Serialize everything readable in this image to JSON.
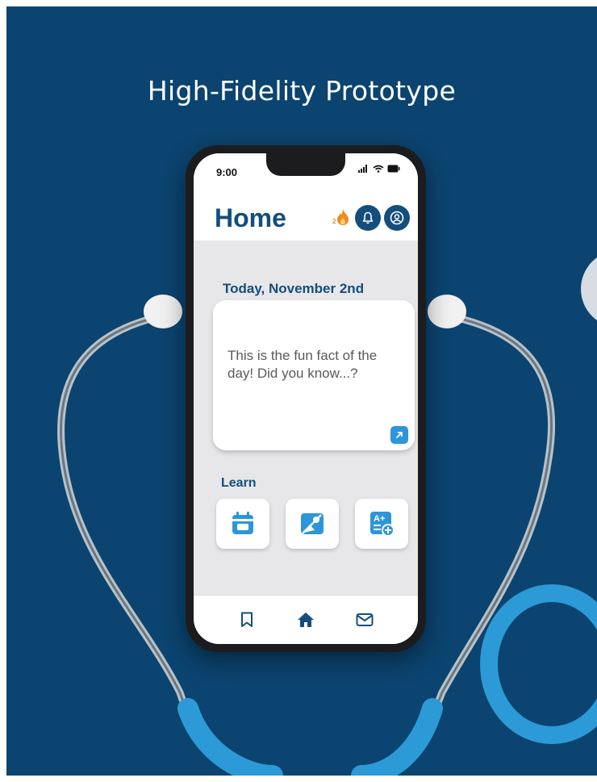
{
  "headline": "High-Fidelity Prototype",
  "status_bar": {
    "time": "9:00"
  },
  "app_bar": {
    "title": "Home",
    "streak_count": "2",
    "icons": [
      "flame-icon",
      "bell-icon",
      "profile-icon"
    ]
  },
  "today": {
    "date_label": "Today, November 2nd",
    "fun_fact": "This is the fun fact of the day! Did you know...?",
    "open_icon": "external-link-icon"
  },
  "learn": {
    "heading": "Learn",
    "tiles": [
      "calendar-icon",
      "image-icon",
      "grades-icon"
    ]
  },
  "bottom_nav": {
    "items": [
      "bookmark-icon",
      "home-icon",
      "mail-icon"
    ],
    "active": "home-icon"
  },
  "colors": {
    "background": "#0b4470",
    "brand": "#134e7c",
    "accent": "#2d96d8",
    "streak": "#f28a1e"
  }
}
